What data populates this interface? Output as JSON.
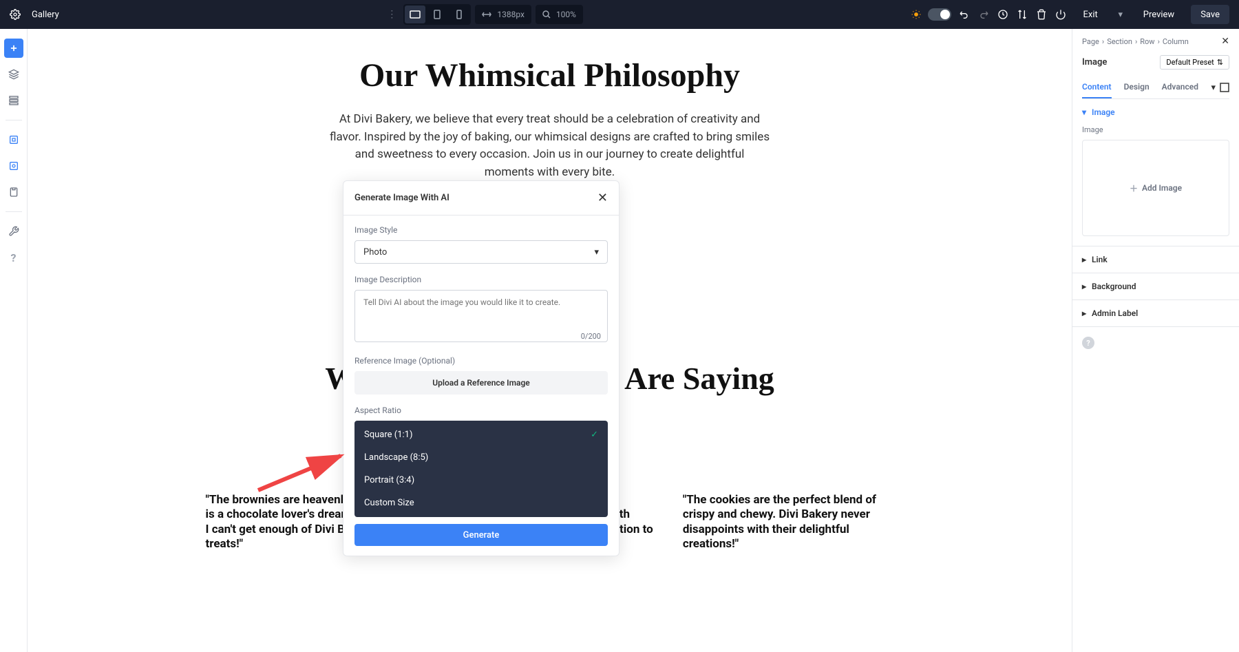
{
  "topbar": {
    "title": "Gallery",
    "width_value": "1388px",
    "zoom_value": "100%",
    "exit": "Exit",
    "preview": "Preview",
    "save": "Save"
  },
  "content": {
    "h1": "Our Whimsical Philosophy",
    "para": "At Divi Bakery, we believe that every treat should be a celebration of creativity and flavor. Inspired by the joy of baking, our whimsical designs are crafted to bring smiles and sweetness to every occasion. Join us in our journey to create delightful moments with every bite.",
    "h2": "What Our Customers Are Saying",
    "testimonials": [
      "\"The brownies are heavenly! Every bite is a chocolate lover's dream come true. I can't get enough of Divi Bakery's treats!\"",
      "\"I ordered a custom cake for my daughter's birthday, and it was both beautiful and delicious. The attention to detail was incredible!\"",
      "\"The cookies are the perfect blend of crispy and chewy. Divi Bakery never disappoints with their delightful creations!\""
    ]
  },
  "modal": {
    "title": "Generate Image With AI",
    "image_style_label": "Image Style",
    "image_style_value": "Photo",
    "description_label": "Image Description",
    "description_placeholder": "Tell Divi AI about the image you would like it to create.",
    "char_count": "0/200",
    "reference_label": "Reference Image (Optional)",
    "upload_button": "Upload a Reference Image",
    "aspect_label": "Aspect Ratio",
    "aspect_options": [
      "Square (1:1)",
      "Landscape (8:5)",
      "Portrait (3:4)",
      "Custom Size"
    ],
    "generate": "Generate"
  },
  "panel": {
    "breadcrumb": [
      "Page",
      "Section",
      "Row",
      "Column"
    ],
    "title": "Image",
    "preset": "Default Preset",
    "tabs": [
      "Content",
      "Design",
      "Advanced"
    ],
    "accordion_image": "Image",
    "field_image_label": "Image",
    "add_image": "Add Image",
    "accordion_link": "Link",
    "accordion_background": "Background",
    "accordion_admin": "Admin Label"
  }
}
